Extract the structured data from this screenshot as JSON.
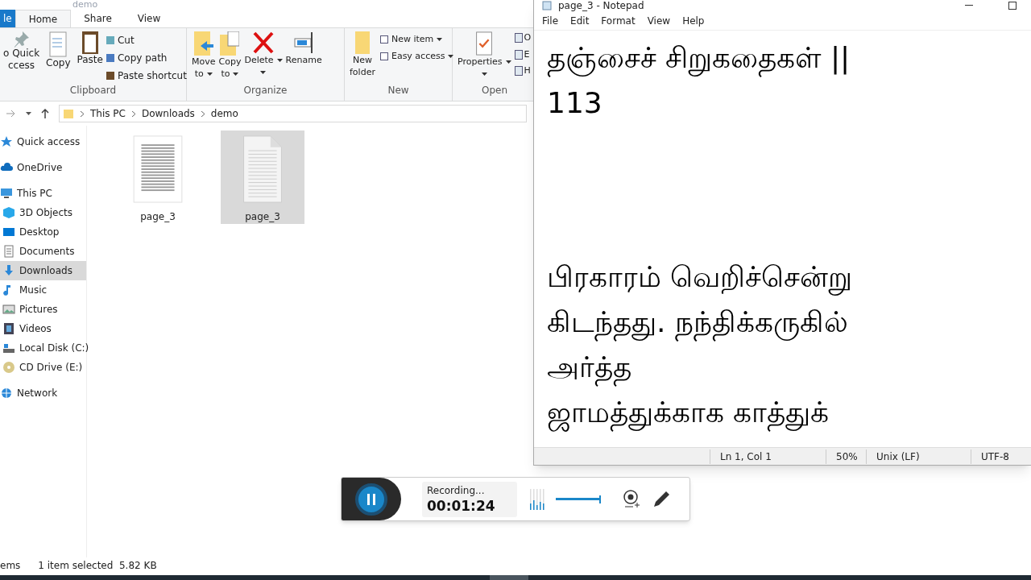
{
  "explorer": {
    "title": "demo",
    "tabs": [
      {
        "label": "le",
        "kind": "file",
        "selected": false
      },
      {
        "label": "Home",
        "kind": "tab",
        "selected": true
      },
      {
        "label": "Share",
        "kind": "tab",
        "selected": false
      },
      {
        "label": "View",
        "kind": "tab",
        "selected": false
      }
    ],
    "ribbon": {
      "clipboard": {
        "label": "Clipboard",
        "pin": [
          "o Quick",
          "ccess"
        ],
        "copy": "Copy",
        "paste": "Paste",
        "small": [
          "Cut",
          "Copy path",
          "Paste shortcut"
        ]
      },
      "organize": {
        "label": "Organize",
        "move": [
          "Move",
          "to"
        ],
        "copyto": [
          "Copy",
          "to"
        ],
        "delete": "Delete",
        "rename": "Rename"
      },
      "new": {
        "label": "New",
        "folder": [
          "New",
          "folder"
        ],
        "small": [
          "New item",
          "Easy access"
        ]
      },
      "open": {
        "label": "Open",
        "properties": "Properties",
        "small": [
          "O",
          "E",
          "H"
        ]
      }
    },
    "breadcrumb": [
      "This PC",
      "Downloads",
      "demo"
    ],
    "nav": [
      {
        "label": "Quick access",
        "kind": "star",
        "selected": false
      },
      {
        "label": "OneDrive",
        "kind": "cloud",
        "selected": false
      },
      {
        "label": "This PC",
        "kind": "pc",
        "selected": false,
        "children": [
          {
            "label": "3D Objects",
            "kind": "cube",
            "selected": false
          },
          {
            "label": "Desktop",
            "kind": "desktop",
            "selected": false
          },
          {
            "label": "Documents",
            "kind": "doc",
            "selected": false
          },
          {
            "label": "Downloads",
            "kind": "download",
            "selected": true
          },
          {
            "label": "Music",
            "kind": "music",
            "selected": false
          },
          {
            "label": "Pictures",
            "kind": "pictures",
            "selected": false
          },
          {
            "label": "Videos",
            "kind": "videos",
            "selected": false
          },
          {
            "label": "Local Disk (C:)",
            "kind": "disk",
            "selected": false
          },
          {
            "label": "CD Drive (E:)",
            "kind": "cd",
            "selected": false
          }
        ]
      },
      {
        "label": "Network",
        "kind": "network",
        "selected": false
      }
    ],
    "files": [
      {
        "name": "page_3",
        "kind": "scan",
        "selected": false
      },
      {
        "name": "page_3",
        "kind": "text",
        "selected": true
      }
    ],
    "status": [
      "ems",
      "1 item selected  5.82 KB"
    ]
  },
  "notepad": {
    "title": "page_3 - Notepad",
    "menu": [
      "File",
      "Edit",
      "Format",
      "View",
      "Help"
    ],
    "paragraphs": [
      [
        "தஞ்சைச் சிறுகதைகள் ||",
        "113"
      ],
      [
        "பிரகாரம் வெறிச்சென்று",
        "கிடந்தது. நந்திக்கருகில்",
        "அர்த்த",
        "ஜாமத்துக்காக காத்துக்"
      ]
    ],
    "status": [
      "Ln 1, Col 1",
      "50%",
      "Unix (LF)",
      "UTF-8"
    ]
  },
  "recorder": {
    "label": "Recording...",
    "time": "00:01:24",
    "volume": {
      "level": 0.85
    }
  }
}
